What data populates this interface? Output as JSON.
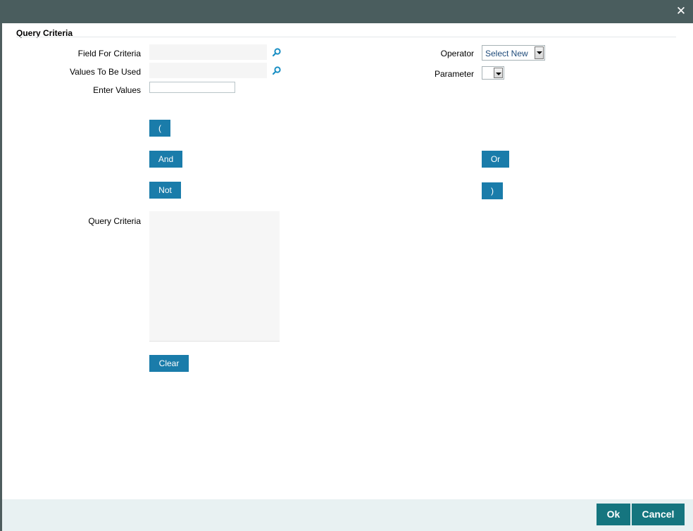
{
  "window": {
    "close_symbol": "✕"
  },
  "section": {
    "title": "Query Criteria"
  },
  "fields": {
    "field_for_criteria": {
      "label": "Field For Criteria",
      "value": ""
    },
    "values_to_be_used": {
      "label": "Values To Be Used",
      "value": ""
    },
    "enter_values": {
      "label": "Enter Values",
      "value": ""
    },
    "operator": {
      "label": "Operator",
      "selected": "Select New"
    },
    "parameter": {
      "label": "Parameter",
      "selected": ""
    },
    "query_criteria": {
      "label": "Query Criteria",
      "value": ""
    }
  },
  "buttons": {
    "open_paren": "(",
    "and": "And",
    "or": "Or",
    "not": "Not",
    "close_paren": ")",
    "clear": "Clear"
  },
  "footer": {
    "ok": "Ok",
    "cancel": "Cancel"
  },
  "colors": {
    "button_blue": "#1a7caa",
    "footer_teal": "#15757f",
    "search_icon": "#1a8fc4"
  },
  "icons": [
    "close-icon",
    "search-icon",
    "chevron-down-icon"
  ]
}
